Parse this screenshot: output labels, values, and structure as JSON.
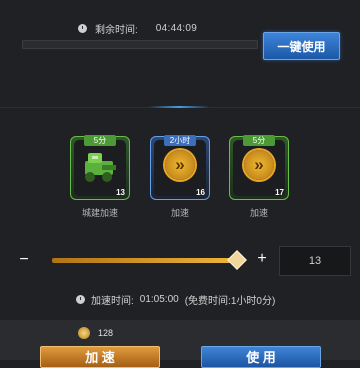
{
  "timer": {
    "label": "剩余时间:",
    "value": "04:44:09"
  },
  "use_one_button": "一键使用",
  "items": [
    {
      "tag": "5分",
      "count": "13",
      "label": "城建加速",
      "style": "green",
      "icon": "robot-icon"
    },
    {
      "tag": "2小时",
      "count": "16",
      "label": "加速",
      "style": "blue",
      "icon": "speedup-chevron-icon"
    },
    {
      "tag": "5分",
      "count": "17",
      "label": "加速",
      "style": "green",
      "icon": "speedup-chevron-icon"
    }
  ],
  "slider": {
    "minus": "−",
    "plus": "+",
    "value": "13"
  },
  "accel": {
    "label": "加速时间:",
    "value": "01:05:00",
    "free": "(免费时间:1小时0分)"
  },
  "cost": {
    "amount": "128",
    "icon": "coin-icon"
  },
  "buttons": {
    "speedup": "加 速",
    "use": "使 用"
  },
  "colors": {
    "accent_blue": "#2a6fc4",
    "accent_orange": "#c97f24",
    "slider_gold": "#f0b43e"
  }
}
